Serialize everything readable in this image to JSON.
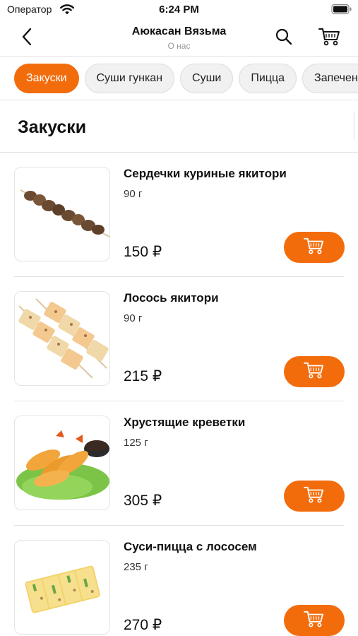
{
  "status_bar": {
    "carrier": "Оператор",
    "time": "6:24 PM"
  },
  "nav": {
    "title": "Аюкасан Вязьма",
    "subtitle": "О нас",
    "back_icon": "chevron-left-icon",
    "search_icon": "search-icon",
    "cart_icon": "shopping-cart-icon"
  },
  "tabs": [
    {
      "label": "Закуски",
      "active": true
    },
    {
      "label": "Суши гункан",
      "active": false
    },
    {
      "label": "Суши",
      "active": false
    },
    {
      "label": "Пицца",
      "active": false
    },
    {
      "label": "Запеченные роллы",
      "active": false
    }
  ],
  "section": {
    "title": "Закуски"
  },
  "products": [
    {
      "name": "Сердечки куриные якитори",
      "weight": "90 г",
      "price": "150 ₽",
      "image": "chicken-hearts-skewer"
    },
    {
      "name": "Лосось якитори",
      "weight": "90 г",
      "price": "215 ₽",
      "image": "salmon-skewers"
    },
    {
      "name": "Хрустящие креветки",
      "weight": "125 г",
      "price": "305 ₽",
      "image": "fried-shrimp"
    },
    {
      "name": "Суси-пицца с лососем",
      "weight": "235 г",
      "price": "270 ₽",
      "image": "sushi-pizza"
    }
  ],
  "colors": {
    "accent": "#f36c0c",
    "divider": "#e2e2e2",
    "tab_bg": "#f1f1f1"
  }
}
